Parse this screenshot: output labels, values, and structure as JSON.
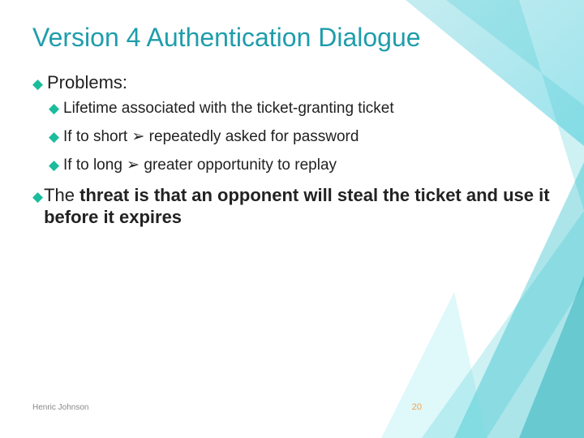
{
  "title": "Version 4 Authentication Dialogue",
  "bullets": {
    "problems_label": "Problems:",
    "sub1": "Lifetime associated with the ticket-granting ticket",
    "sub2_prefix": "If to short ",
    "sub2_suffix": " repeatedly asked for password",
    "sub3_prefix": "If to long ",
    "sub3_suffix": " greater opportunity to replay",
    "threat_prefix": "The ",
    "threat_rest": "threat is that an opponent will steal the ticket and use it before it expires"
  },
  "glyphs": {
    "diamond": "◆",
    "arrow": "➢"
  },
  "footer": {
    "author": "Henric Johnson",
    "page": "20"
  }
}
